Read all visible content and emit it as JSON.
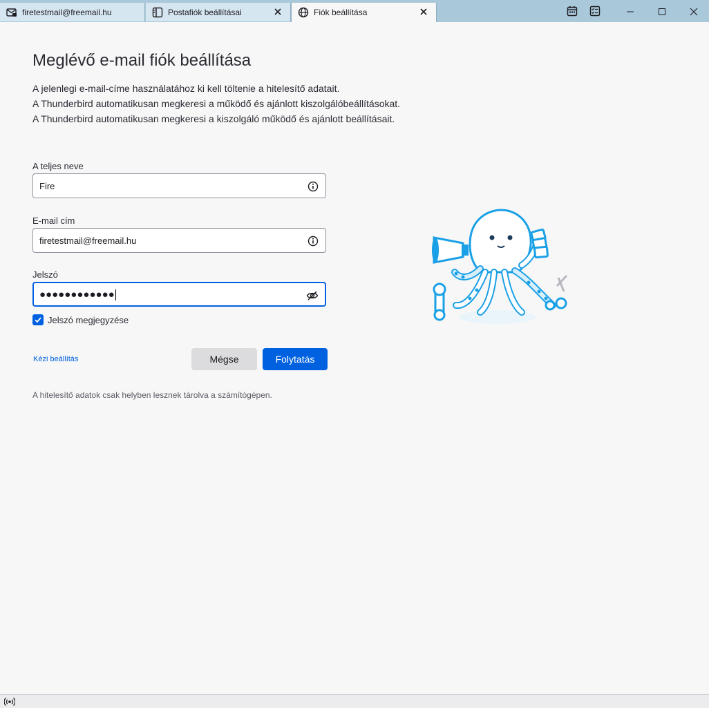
{
  "tabs": [
    {
      "label": "firetestmail@freemail.hu",
      "icon": "mail-lock-icon"
    },
    {
      "label": "Postafiók beállításai",
      "icon": "account-settings-icon"
    },
    {
      "label": "Fiók beállítása",
      "icon": "globe-icon"
    }
  ],
  "toolbar": {
    "calendar_icon": "calendar-icon",
    "tasks_icon": "tasks-icon"
  },
  "page": {
    "title": "Meglévő e-mail fiók beállítása",
    "description": [
      "A jelenlegi e-mail-címe használatához ki kell töltenie a hitelesítő adatait.",
      "A Thunderbird automatikusan megkeresi a működő és ajánlott kiszolgálóbeállításokat.",
      "A Thunderbird automatikusan megkeresi a kiszolgáló működő és ajánlott beállításait."
    ]
  },
  "form": {
    "name_label": "A teljes neve",
    "name_value": "Fire",
    "email_label": "E-mail cím",
    "email_value": "firetestmail@freemail.hu",
    "password_label": "Jelszó",
    "password_value": "●●●●●●●●●●●●",
    "remember_label": "Jelszó megjegyzése",
    "remember_checked": true
  },
  "actions": {
    "manual_label": "Kézi beállítás",
    "cancel_label": "Mégse",
    "continue_label": "Folytatás"
  },
  "note": "A hitelesítő adatok csak helyben lesznek tárolva a számítógépen.",
  "colors": {
    "accent": "#0061e0",
    "tabbar": "#a9c8d9",
    "mascot": "#1aa0e6"
  }
}
